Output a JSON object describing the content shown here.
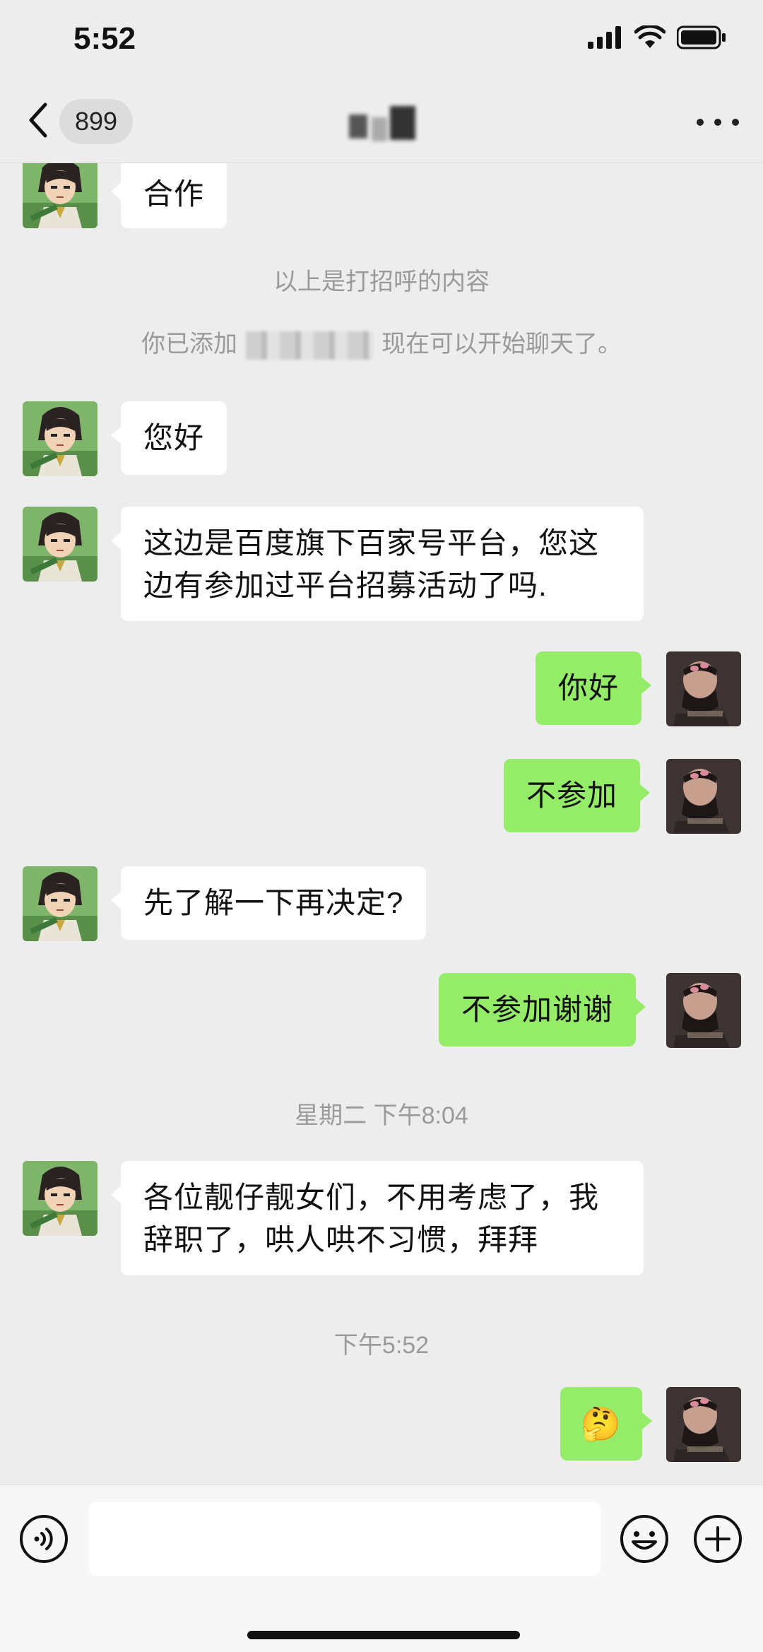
{
  "status_bar": {
    "time": "5:52"
  },
  "header": {
    "unread_count": "899",
    "icons": [
      "back-chevron-icon",
      "more-icon"
    ]
  },
  "messages": [
    {
      "side": "left",
      "text": "合作"
    },
    {
      "type": "system",
      "text": "以上是打招呼的内容"
    },
    {
      "type": "system_added",
      "prefix": "你已添加",
      "suffix": "现在可以开始聊天了。"
    },
    {
      "side": "left",
      "text": "您好"
    },
    {
      "side": "left",
      "line1": "这边是百度旗下百家号平台，您这",
      "line2": "边有参加过平台招募活动了吗."
    },
    {
      "side": "right",
      "text": "你好"
    },
    {
      "side": "right",
      "text": "不参加"
    },
    {
      "side": "left",
      "text": "先了解一下再决定?"
    },
    {
      "side": "right",
      "text": "不参加谢谢"
    },
    {
      "type": "timestamp",
      "text": "星期二 下午8:04"
    },
    {
      "side": "left",
      "line1": "各位靓仔靓女们，不用考虑了，我",
      "line2": "辞职了，哄人哄不习惯，拜拜"
    },
    {
      "type": "timestamp",
      "text": "下午5:52"
    },
    {
      "side": "right",
      "emoji": "🤔"
    }
  ],
  "input_bar": {
    "placeholder": "",
    "icons": [
      "voice-icon",
      "emoji-icon",
      "plus-icon"
    ]
  },
  "colors": {
    "background": "#ededed",
    "sent_bubble": "#95ec69",
    "received_bubble": "#ffffff",
    "system_text": "#9a9a9a"
  }
}
